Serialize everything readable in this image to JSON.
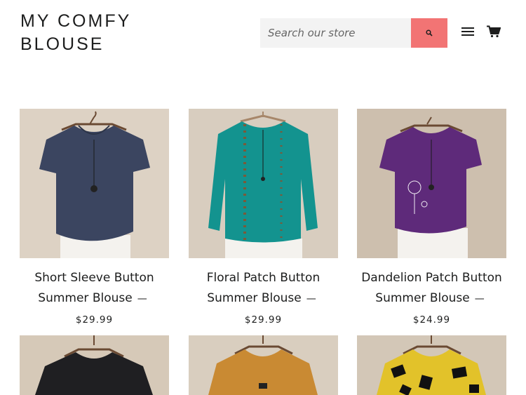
{
  "header": {
    "logo_line1": "MY COMFY",
    "logo_line2": "BLOUSE",
    "search_placeholder": "Search our store",
    "accent_color": "#f27474"
  },
  "icons": [
    "search-icon",
    "menu-icon",
    "cart-icon"
  ],
  "products": [
    {
      "title_line1": "Short Sleeve Button",
      "title_line2": "Summer Blouse",
      "dash": "—",
      "price": "$29.99",
      "color": "#3b4560"
    },
    {
      "title_line1": "Floral Patch Button",
      "title_line2": "Summer Blouse",
      "dash": "—",
      "price": "$29.99",
      "color": "#13938f"
    },
    {
      "title_line1": "Dandelion Patch Button",
      "title_line2": "Summer Blouse",
      "dash": "—",
      "price": "$24.99",
      "color": "#5e2a7a"
    },
    {
      "color": "#1f1f22"
    },
    {
      "color": "#c98a33"
    },
    {
      "color": "#e2c22a"
    }
  ]
}
